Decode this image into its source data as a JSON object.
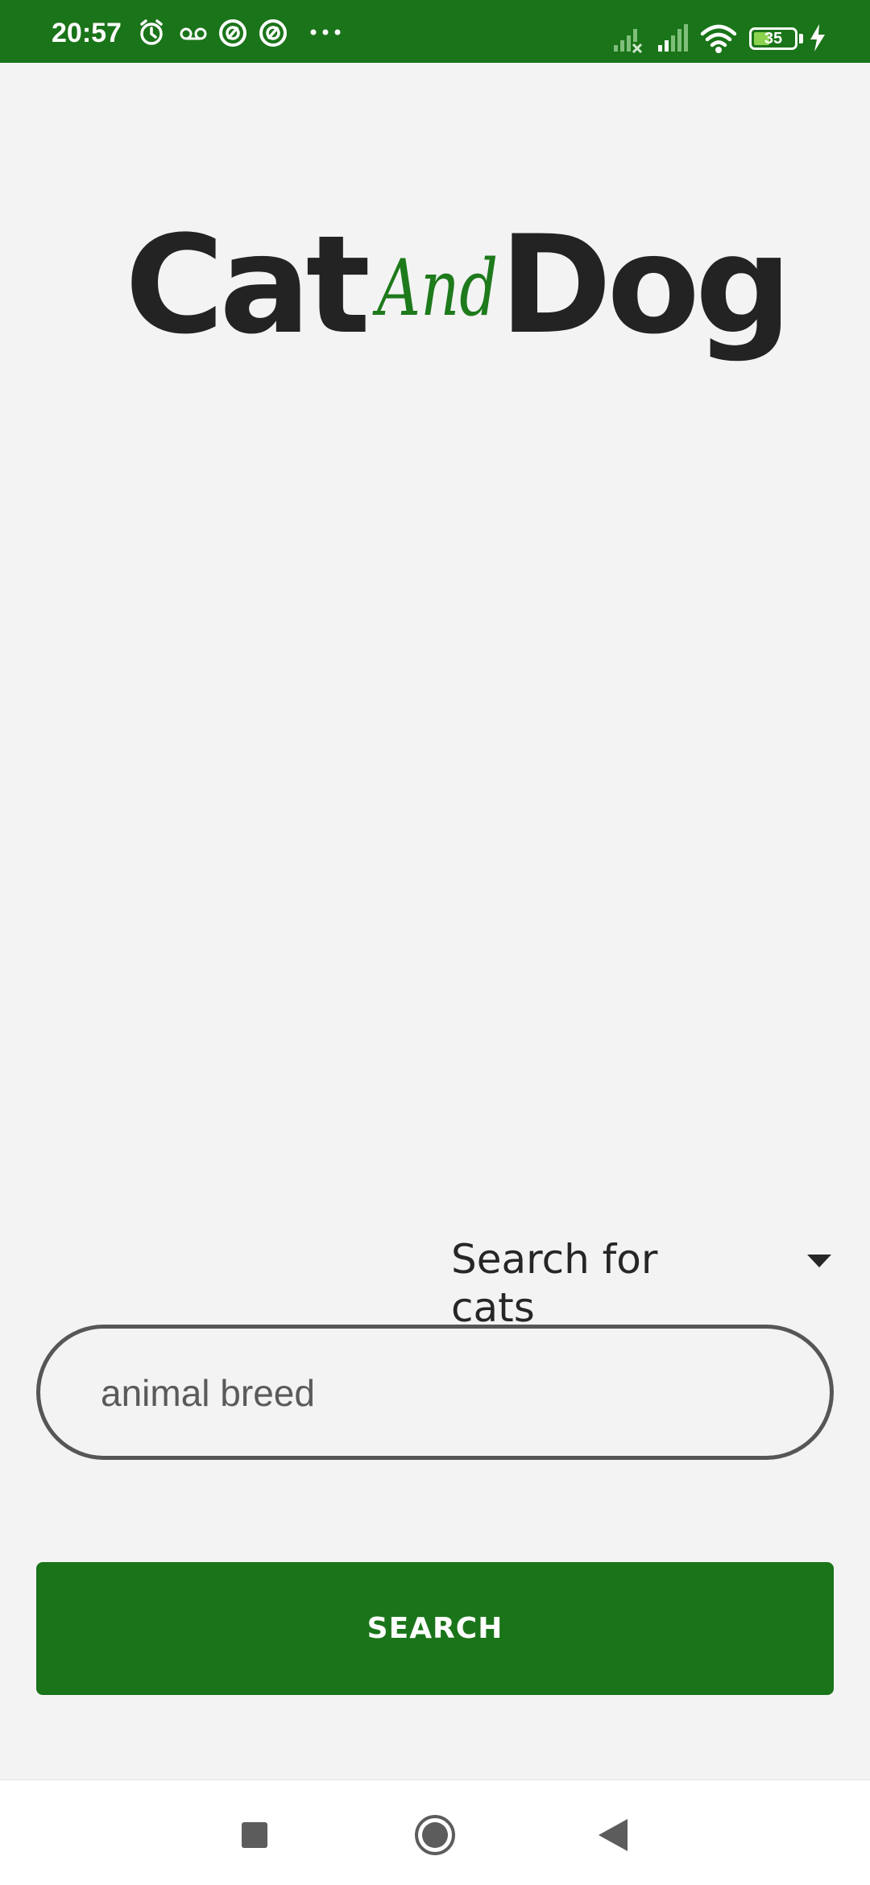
{
  "status_bar": {
    "time": "20:57",
    "battery_level": "35",
    "icons": [
      "alarm-icon",
      "voicemail-icon",
      "app-notification-icon",
      "app-notification-icon",
      "more-dots-icon",
      "signal-no-service-icon",
      "signal-icon",
      "wifi-icon",
      "battery-icon",
      "charging-icon"
    ],
    "background_color": "#1a7419"
  },
  "logo": {
    "word_left": "Cat",
    "word_middle": "And",
    "word_right": "Dog",
    "middle_color": "#1e7a1b"
  },
  "search_type": {
    "selected": "Search for cats"
  },
  "breed_input": {
    "placeholder": "animal breed"
  },
  "search_button": {
    "label": "SEARCH",
    "color": "#1a7419"
  },
  "nav_bar": {
    "icons": [
      "recents-square-icon",
      "home-circle-icon",
      "back-triangle-icon"
    ]
  }
}
